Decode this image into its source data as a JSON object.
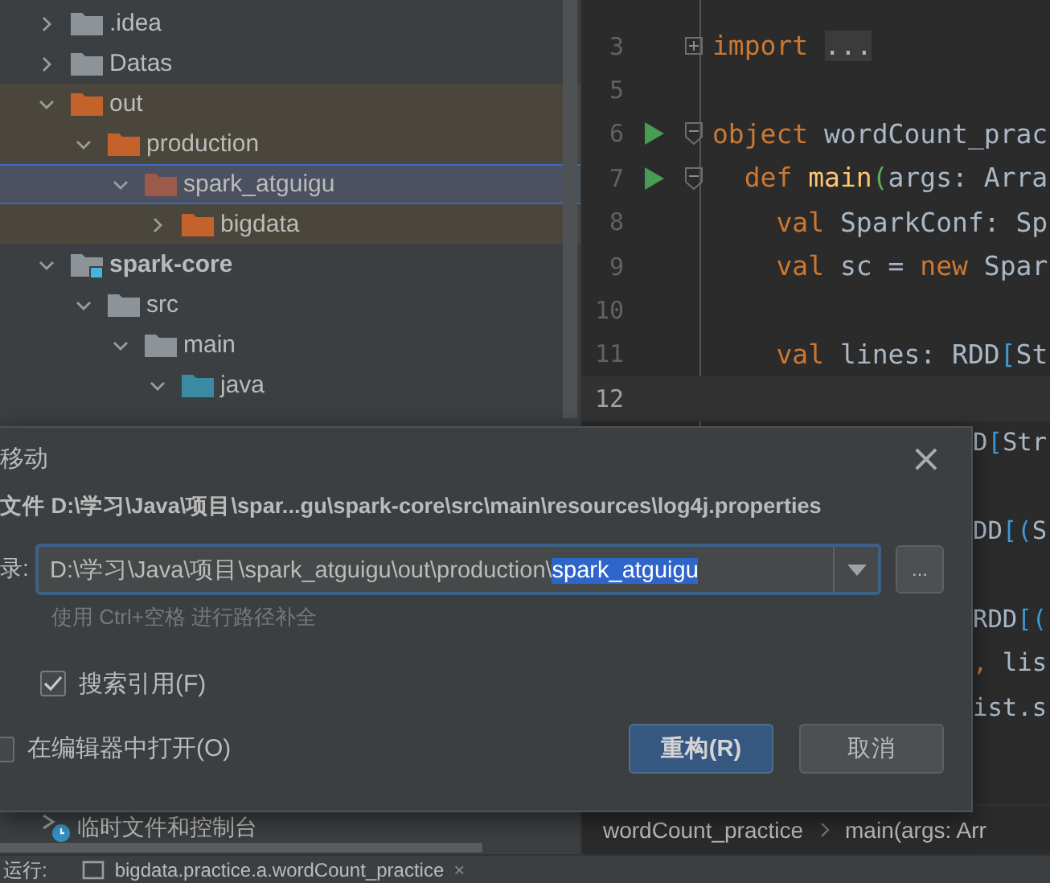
{
  "project_tree": [
    {
      "name": ".idea",
      "kind": "plain",
      "expanded": false,
      "selected": false
    },
    {
      "name": "Datas",
      "kind": "plain",
      "expanded": false,
      "selected": false
    },
    {
      "name": "out",
      "kind": "excluded",
      "expanded": true,
      "selected": false,
      "children": [
        {
          "name": "production",
          "kind": "excluded",
          "expanded": true,
          "selected": false,
          "children": [
            {
              "name": "spark_atguigu",
              "kind": "excluded",
              "expanded": true,
              "selected": true,
              "children": [
                {
                  "name": "bigdata",
                  "kind": "excluded",
                  "expanded": false,
                  "selected": false
                }
              ]
            }
          ]
        }
      ]
    },
    {
      "name": "spark-core",
      "kind": "module",
      "expanded": true,
      "selected": false,
      "children": [
        {
          "name": "src",
          "kind": "plain",
          "expanded": true,
          "selected": false,
          "children": [
            {
              "name": "main",
              "kind": "plain",
              "expanded": true,
              "selected": false,
              "children": [
                {
                  "name": "java",
                  "kind": "source",
                  "expanded": true,
                  "selected": false
                }
              ]
            }
          ]
        }
      ]
    }
  ],
  "scratches": {
    "label": "临时文件和控制台"
  },
  "editor": {
    "lines": [
      {
        "number": "3",
        "run": false,
        "current": false,
        "folded": true,
        "tokens": [
          {
            "text": "import",
            "kind": "kw"
          },
          {
            "text": "...",
            "kind": "folded"
          }
        ]
      },
      {
        "number": "5",
        "run": false,
        "current": false
      },
      {
        "number": "6",
        "run": true,
        "current": false,
        "folded": false,
        "tokens": [
          {
            "text": "object",
            "kind": "kw"
          },
          {
            "text": " wordCount_prac",
            "kind": "plain"
          }
        ]
      },
      {
        "number": "7",
        "run": true,
        "current": false,
        "folded": false,
        "tokens": [
          {
            "text": "  def",
            "kind": "kw"
          },
          {
            "text": " main",
            "kind": "fn"
          },
          {
            "text": "(",
            "kind": "paren"
          },
          {
            "text": "args: Arra",
            "kind": "plain"
          }
        ]
      },
      {
        "number": "8",
        "run": false,
        "current": false,
        "tokens": [
          {
            "text": "    val",
            "kind": "kw"
          },
          {
            "text": " SparkConf: Sp",
            "kind": "plain"
          }
        ]
      },
      {
        "number": "9",
        "run": false,
        "current": false,
        "tokens": [
          {
            "text": "    val",
            "kind": "kw"
          },
          {
            "text": " sc = ",
            "kind": "plain"
          },
          {
            "text": "new",
            "kind": "kw"
          },
          {
            "text": " Spar",
            "kind": "plain"
          }
        ]
      },
      {
        "number": "10",
        "run": false,
        "current": false
      },
      {
        "number": "11",
        "run": false,
        "current": false,
        "tokens": [
          {
            "text": "    val",
            "kind": "kw"
          },
          {
            "text": " lines: RDD",
            "kind": "plain"
          },
          {
            "text": "[",
            "kind": "bracket"
          },
          {
            "text": "St",
            "kind": "plain"
          }
        ]
      },
      {
        "number": "12",
        "run": false,
        "current": true
      }
    ],
    "covered_lines": [
      {
        "kind": "code",
        "tokens": [
          {
            "text": "D",
            "kind": "plain"
          },
          {
            "text": "[",
            "kind": "bracket"
          },
          {
            "text": "Str",
            "kind": "plain"
          }
        ]
      },
      {
        "kind": "blank"
      },
      {
        "kind": "code",
        "tokens": [
          {
            "text": "DD",
            "kind": "plain"
          },
          {
            "text": "[(",
            "kind": "bracket"
          },
          {
            "text": "S",
            "kind": "plain"
          }
        ]
      },
      {
        "kind": "blank"
      },
      {
        "kind": "code",
        "tokens": [
          {
            "text": "RDD",
            "kind": "plain"
          },
          {
            "text": "[(",
            "kind": "bracket"
          }
        ]
      },
      {
        "kind": "code",
        "tokens": [
          {
            "text": ",",
            "kind": "kw"
          },
          {
            "text": " lis",
            "kind": "plain"
          }
        ]
      },
      {
        "kind": "code",
        "tokens": [
          {
            "text": "ist.s",
            "kind": "plain"
          }
        ]
      }
    ],
    "breadcrumbs": [
      "wordCount_practice",
      "main(args: Arr"
    ]
  },
  "run_bar": {
    "label": "运行:",
    "tab": "bigdata.practice.a.wordCount_practice",
    "close": "×"
  },
  "dialog": {
    "title": "移动",
    "close": "×",
    "heading": "文件 D:\\学习\\Java\\项目\\spar...gu\\spark-core\\src\\main\\resources\\log4j.properties",
    "field_label": "录:",
    "field_value": "D:\\学习\\Java\\项目\\spark_atguigu\\out\\production\\",
    "field_selection": "spark_atguigu",
    "browse": "...",
    "hint": "使用 Ctrl+空格 进行路径补全",
    "options": [
      {
        "label": "搜索引用(F)",
        "checked": true
      },
      {
        "label": "在编辑器中打开(O)",
        "checked": false
      }
    ],
    "buttons": [
      {
        "label": "重构(R)",
        "primary": true
      },
      {
        "label": "取消",
        "primary": false
      }
    ]
  }
}
